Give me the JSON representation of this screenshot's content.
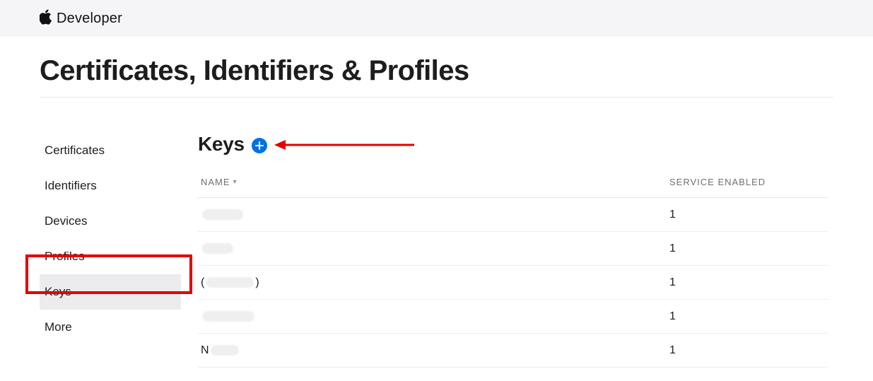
{
  "header": {
    "brand": "Developer"
  },
  "page": {
    "title": "Certificates, Identifiers & Profiles"
  },
  "sidebar": {
    "items": [
      {
        "label": "Certificates",
        "active": false
      },
      {
        "label": "Identifiers",
        "active": false
      },
      {
        "label": "Devices",
        "active": false
      },
      {
        "label": "Profiles",
        "active": false
      },
      {
        "label": "Keys",
        "active": true
      },
      {
        "label": "More",
        "active": false
      }
    ]
  },
  "section": {
    "title": "Keys"
  },
  "table": {
    "columns": {
      "name": "NAME",
      "service": "SERVICE ENABLED"
    },
    "rows": [
      {
        "name_prefix": "",
        "blur_w": 58,
        "blur_h": 15,
        "service": "1"
      },
      {
        "name_prefix": "",
        "blur_w": 44,
        "blur_h": 15,
        "service": "1"
      },
      {
        "name_prefix": "(",
        "blur_w": 68,
        "blur_h": 15,
        "suffix": ")",
        "service": "1"
      },
      {
        "name_prefix": "",
        "blur_w": 74,
        "blur_h": 15,
        "service": "1"
      },
      {
        "name_prefix": "N",
        "blur_w": 40,
        "blur_h": 15,
        "service": "1"
      }
    ]
  }
}
